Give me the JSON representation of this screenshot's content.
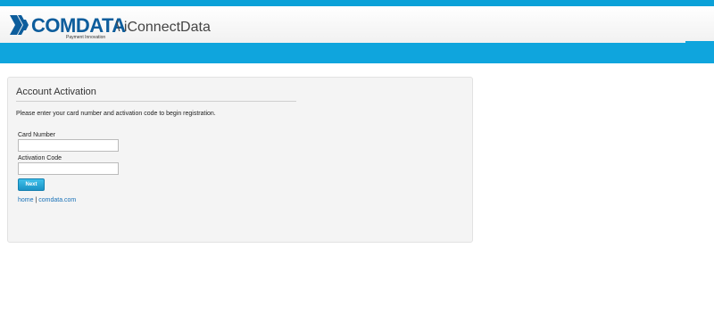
{
  "header": {
    "brand": "COMDATA",
    "tagline": "Payment Innovation",
    "app_name": "\\ iConnectData"
  },
  "panel": {
    "title": "Account Activation",
    "instructions": "Please enter your card number and activation code to begin registration.",
    "card_number_label": "Card Number",
    "card_number_value": "",
    "activation_code_label": "Activation Code",
    "activation_code_value": "",
    "next_label": "Next"
  },
  "footer": {
    "home_link": "home",
    "separator": "|",
    "comdata_link": "comdata.com"
  },
  "colors": {
    "accent": "#0fa5dd",
    "brand": "#0d5d9c",
    "link": "#1a72b8"
  }
}
